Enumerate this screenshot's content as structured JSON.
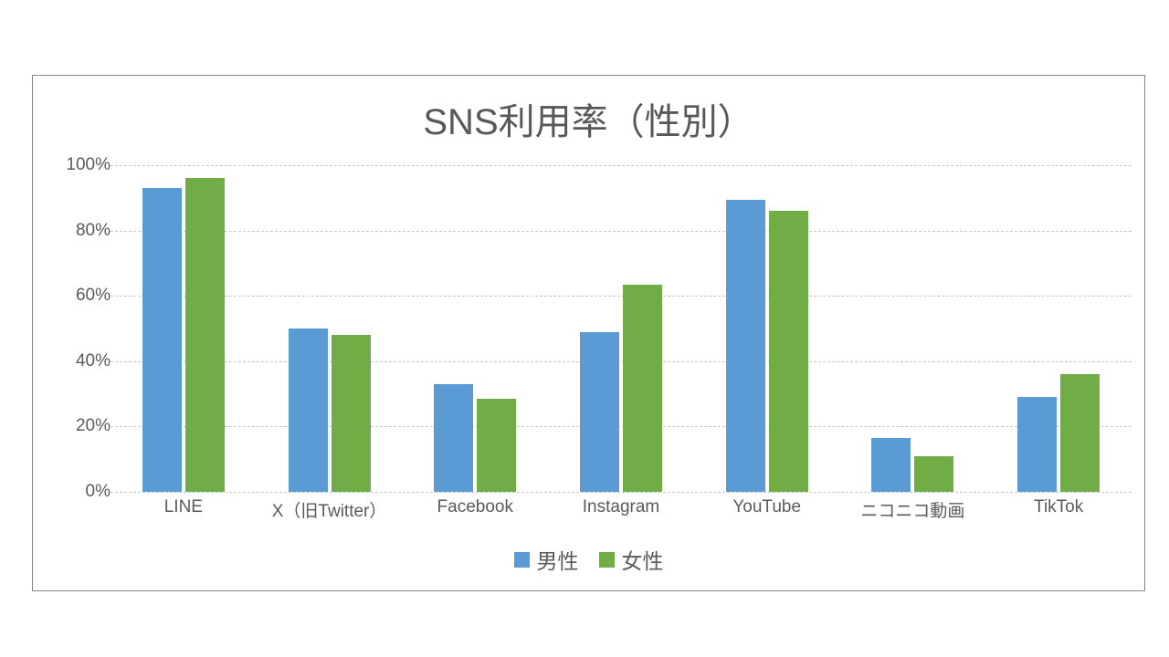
{
  "chart_data": {
    "type": "bar",
    "title": "SNS利用率（性別）",
    "xlabel": "",
    "ylabel": "",
    "categories": [
      "LINE",
      "X（旧Twitter）",
      "Facebook",
      "Instagram",
      "YouTube",
      "ニコニコ動画",
      "TikTok"
    ],
    "series": [
      {
        "name": "男性",
        "color": "#5B9BD5",
        "values": [
          93,
          50,
          33,
          49,
          89.5,
          16.5,
          29
        ]
      },
      {
        "name": "女性",
        "color": "#70AD47",
        "values": [
          96,
          48,
          28.5,
          63.5,
          86,
          11,
          36
        ]
      }
    ],
    "ylim": [
      0,
      100
    ],
    "ytick_values": [
      100,
      80,
      60,
      40,
      20,
      0
    ],
    "ytick_labels": [
      "100%",
      "80%",
      "60%",
      "40%",
      "20%",
      "0%"
    ],
    "grid": true,
    "grid_color": "#c9c9c9",
    "legend_position": "bottom",
    "value_format": "percent",
    "border_color": "#868686",
    "background": "#ffffff",
    "text_color": "#5a5a5a"
  }
}
